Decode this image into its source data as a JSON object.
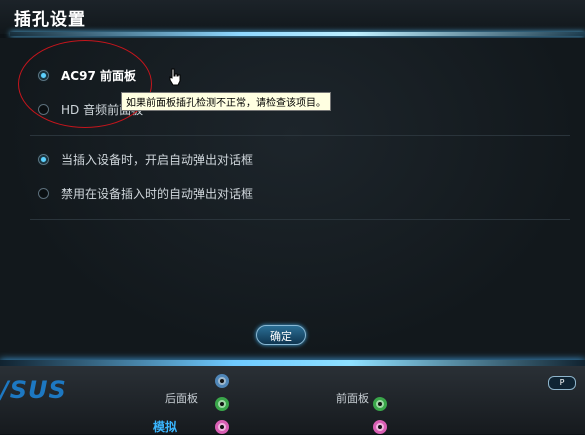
{
  "window": {
    "title": "插孔设置"
  },
  "panel": {
    "panel_options": [
      {
        "label": "AC97 前面板",
        "selected": true
      },
      {
        "label": "HD 音频前面板",
        "selected": false
      }
    ],
    "popup_options": [
      {
        "label": "当插入设备时，开启自动弹出对话框",
        "selected": true
      },
      {
        "label": "禁用在设备插入时的自动弹出对话框",
        "selected": false
      }
    ],
    "tooltip": "如果前面板插孔检测不正常，请检查该项目。",
    "ok_label": "确定"
  },
  "footer": {
    "logo": "/SUS",
    "rear_label": "后面板",
    "front_label": "前面板",
    "analog_label": "模拟",
    "p_button": "P"
  },
  "colors": {
    "accent": "#5ed2ff",
    "annotation": "#c4151c",
    "jack_blue": "#4f86b8",
    "jack_green": "#3aa64a",
    "jack_pink": "#d95fb4"
  }
}
